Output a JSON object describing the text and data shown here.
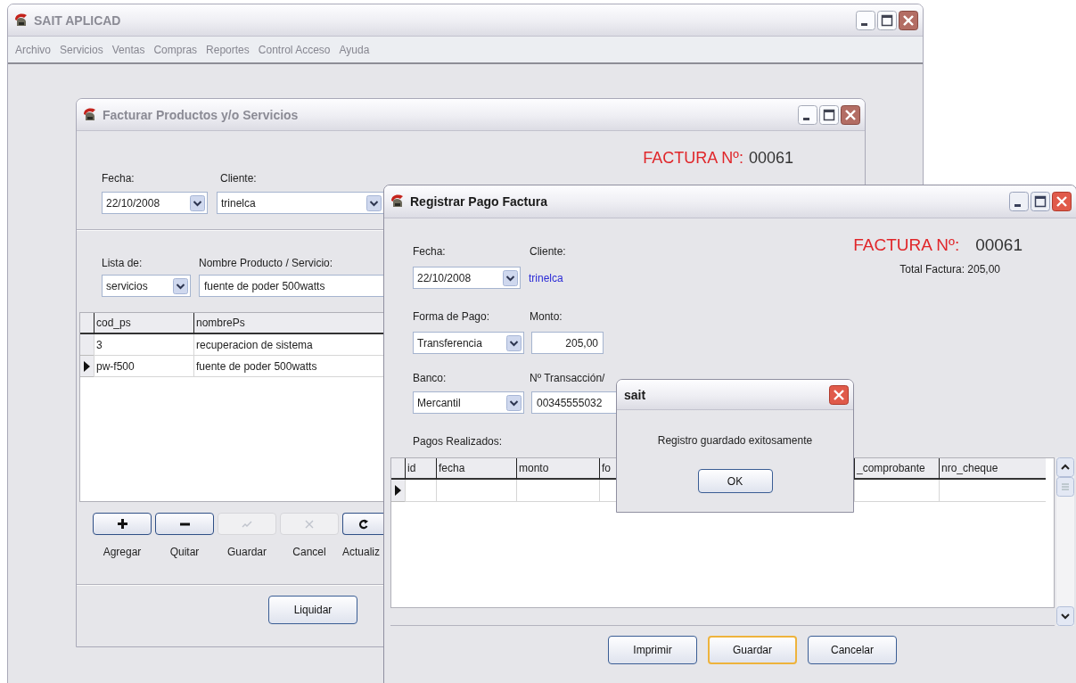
{
  "main_window": {
    "title": "SAIT APLICAD",
    "active": false,
    "menu": [
      {
        "label": "Archivo"
      },
      {
        "label": "Servicios"
      },
      {
        "label": "Ventas"
      },
      {
        "label": "Compras"
      },
      {
        "label": "Reportes"
      },
      {
        "label": "Control Acceso"
      },
      {
        "label": "Ayuda"
      }
    ]
  },
  "invoice_window": {
    "title": "Facturar Productos y/o Servicios",
    "active": false,
    "invoice_label": "FACTURA Nº:",
    "invoice_number": "00061",
    "fecha_label": "Fecha:",
    "fecha": "22/10/2008",
    "cliente_label": "Cliente:",
    "cliente": "trinelca",
    "lista_label": "Lista de:",
    "lista": "servicios",
    "nombre_label": "Nombre Producto / Servicio:",
    "nombre": "fuente de poder 500watts",
    "table": {
      "columns": [
        "cod_ps",
        "nombrePs"
      ],
      "rows": [
        {
          "cells": [
            "3",
            "recuperacion de sistema"
          ],
          "selected": false
        },
        {
          "cells": [
            "pw-f500",
            "fuente de poder 500watts"
          ],
          "selected": true
        }
      ]
    },
    "tools": [
      {
        "kind": "add",
        "label": "Agregar",
        "disabled": false
      },
      {
        "kind": "remove",
        "label": "Quitar",
        "disabled": false
      },
      {
        "kind": "save",
        "label": "Guardar",
        "disabled": true
      },
      {
        "kind": "cancel",
        "label": "Cancel",
        "disabled": true
      },
      {
        "kind": "refresh",
        "label": "Actualiz",
        "disabled": false
      }
    ],
    "buttons": [
      {
        "label": "Liquidar"
      }
    ]
  },
  "payment_window": {
    "title": "Registrar Pago Factura",
    "active": true,
    "invoice_label": "FACTURA Nº:",
    "invoice_number": "00061",
    "total": "Total Factura:  205,00",
    "fecha_label": "Fecha:",
    "fecha": "22/10/2008",
    "cliente_label": "Cliente:",
    "cliente": "trinelca",
    "forma_label": "Forma de Pago:",
    "forma": "Transferencia",
    "monto_label": "Monto:",
    "monto": "205,00",
    "banco_label": "Banco:",
    "banco": "Mercantil",
    "transaccion_label": "Nº Transacción/",
    "transaccion": "00345555032",
    "pagos_label": "Pagos Realizados:",
    "table": {
      "columns": [
        "id",
        "fecha",
        "monto",
        "fo",
        "_comprobante",
        "nro_cheque"
      ],
      "rows": [
        {
          "selected": true
        }
      ]
    },
    "buttons": [
      {
        "label": "Imprimir",
        "hovered": false
      },
      {
        "label": "Guardar",
        "hovered": true
      },
      {
        "label": "Cancelar",
        "hovered": false
      }
    ]
  },
  "dialog": {
    "title": "sait",
    "active": true,
    "message": "Registro guardado exitosamente",
    "button": "OK"
  }
}
